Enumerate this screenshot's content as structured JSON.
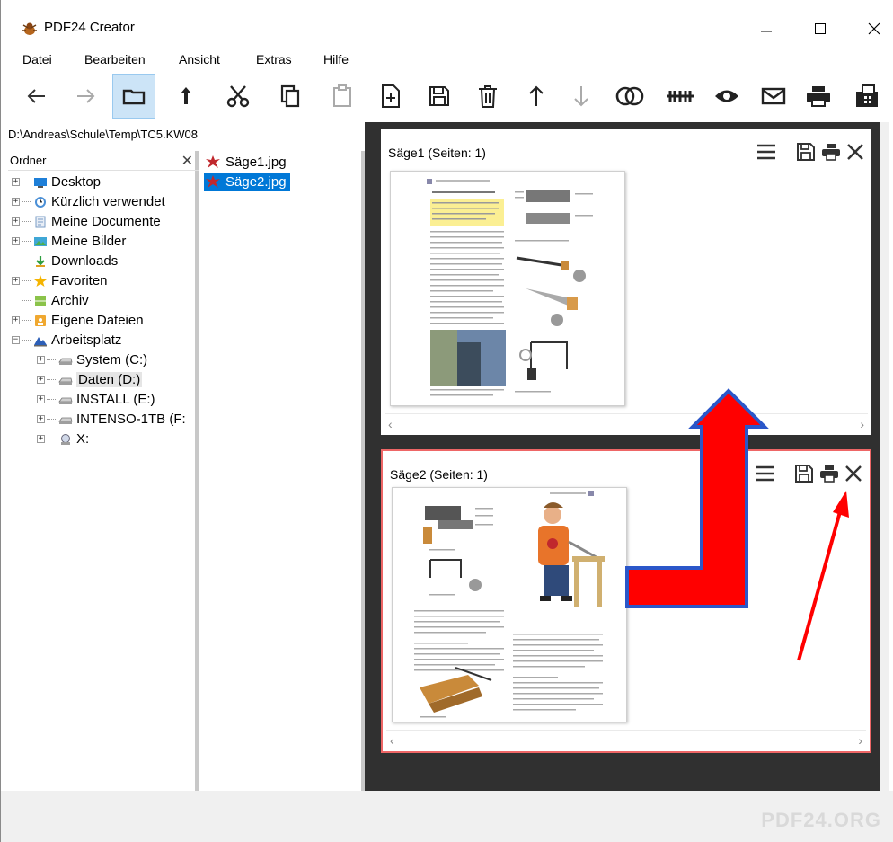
{
  "window": {
    "title": "PDF24 Creator"
  },
  "menu": [
    "Datei",
    "Bearbeiten",
    "Ansicht",
    "Extras",
    "Hilfe"
  ],
  "path": "D:\\Andreas\\Schule\\Temp\\TC5.KW08",
  "tree": {
    "header": "Ordner",
    "items": [
      {
        "label": "Desktop"
      },
      {
        "label": "Kürzlich verwendet"
      },
      {
        "label": "Meine Documente"
      },
      {
        "label": "Meine Bilder"
      },
      {
        "label": "Downloads"
      },
      {
        "label": "Favoriten"
      },
      {
        "label": "Archiv"
      },
      {
        "label": "Eigene Dateien"
      },
      {
        "label": "Arbeitsplatz"
      },
      {
        "label": "System (C:)"
      },
      {
        "label": "Daten (D:)"
      },
      {
        "label": "INSTALL (E:)"
      },
      {
        "label": "INTENSO-1TB (F:"
      },
      {
        "label": "X:"
      }
    ]
  },
  "files": [
    "Säge1.jpg",
    "Säge2.jpg"
  ],
  "documents": [
    {
      "title": "Säge1 (Seiten: 1)"
    },
    {
      "title": "Säge2 (Seiten: 1)"
    }
  ],
  "brand": "PDF24.ORG",
  "colors": {
    "selection": "#0078d7",
    "toolbar_active": "#cce4f7",
    "annotation_red": "#ff0000",
    "annotation_blue": "#2b57c9",
    "viewer_bg": "#303030"
  }
}
